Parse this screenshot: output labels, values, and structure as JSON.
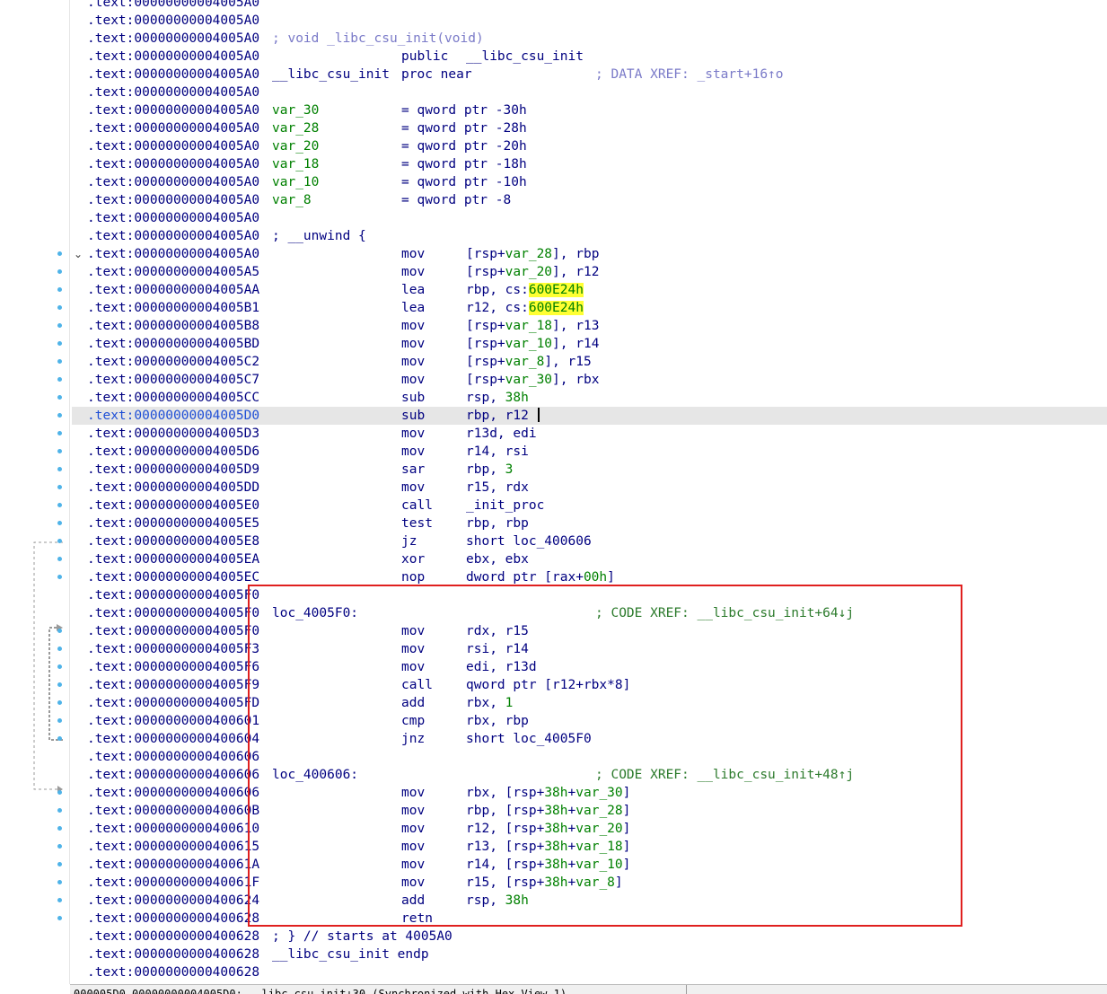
{
  "listing": {
    "rows": [
      {
        "addr": ".text:00000000004005A0",
        "lbl": "",
        "mnem": "",
        "ops": [],
        "cmt": ""
      },
      {
        "addr": ".text:00000000004005A0",
        "lbl": "",
        "mnem": "",
        "ops": [],
        "cmt": ""
      },
      {
        "addr": ".text:00000000004005A0",
        "lbl": "",
        "mnem": "",
        "ops": [
          {
            "t": "; void _libc_csu_init(void)",
            "c": "c"
          }
        ],
        "cmt": "",
        "opsAt": "lbl"
      },
      {
        "addr": ".text:00000000004005A0",
        "lbl": "",
        "mnem": "public",
        "ops": [
          {
            "t": "__libc_csu_init",
            "c": ""
          }
        ],
        "cmt": ""
      },
      {
        "addr": ".text:00000000004005A0",
        "lbl": "__libc_csu_init",
        "mnem": "proc near",
        "ops": [],
        "cmt": "; DATA XREF: _start+16↑o"
      },
      {
        "addr": ".text:00000000004005A0",
        "lbl": "",
        "mnem": "",
        "ops": [],
        "cmt": ""
      },
      {
        "addr": ".text:00000000004005A0",
        "lbl": "var_30",
        "lblc": "g",
        "mnem": "= qword ptr -30h",
        "ops": [],
        "cmt": ""
      },
      {
        "addr": ".text:00000000004005A0",
        "lbl": "var_28",
        "lblc": "g",
        "mnem": "= qword ptr -28h",
        "ops": [],
        "cmt": ""
      },
      {
        "addr": ".text:00000000004005A0",
        "lbl": "var_20",
        "lblc": "g",
        "mnem": "= qword ptr -20h",
        "ops": [],
        "cmt": ""
      },
      {
        "addr": ".text:00000000004005A0",
        "lbl": "var_18",
        "lblc": "g",
        "mnem": "= qword ptr -18h",
        "ops": [],
        "cmt": ""
      },
      {
        "addr": ".text:00000000004005A0",
        "lbl": "var_10",
        "lblc": "g",
        "mnem": "= qword ptr -10h",
        "ops": [],
        "cmt": ""
      },
      {
        "addr": ".text:00000000004005A0",
        "lbl": "var_8",
        "lblc": "g",
        "mnem": "= qword ptr -8",
        "ops": [],
        "cmt": ""
      },
      {
        "addr": ".text:00000000004005A0",
        "lbl": "",
        "mnem": "",
        "ops": [],
        "cmt": ""
      },
      {
        "addr": ".text:00000000004005A0",
        "lbl": "; __unwind {",
        "mnem": "",
        "ops": [],
        "cmt": ""
      },
      {
        "addr": ".text:00000000004005A0",
        "lbl": "",
        "mnem": "mov",
        "ops": [
          {
            "t": "[rsp+",
            "c": ""
          },
          {
            "t": "var_28",
            "c": "g"
          },
          {
            "t": "], rbp",
            "c": ""
          }
        ],
        "cmt": ""
      },
      {
        "addr": ".text:00000000004005A5",
        "lbl": "",
        "mnem": "mov",
        "ops": [
          {
            "t": "[rsp+",
            "c": ""
          },
          {
            "t": "var_20",
            "c": "g"
          },
          {
            "t": "], r12",
            "c": ""
          }
        ],
        "cmt": ""
      },
      {
        "addr": ".text:00000000004005AA",
        "lbl": "",
        "mnem": "lea",
        "ops": [
          {
            "t": "rbp, cs:",
            "c": ""
          },
          {
            "t": "600E24h",
            "c": "hl"
          }
        ],
        "cmt": ""
      },
      {
        "addr": ".text:00000000004005B1",
        "lbl": "",
        "mnem": "lea",
        "ops": [
          {
            "t": "r12, cs:",
            "c": ""
          },
          {
            "t": "600E24h",
            "c": "hl"
          }
        ],
        "cmt": ""
      },
      {
        "addr": ".text:00000000004005B8",
        "lbl": "",
        "mnem": "mov",
        "ops": [
          {
            "t": "[rsp+",
            "c": ""
          },
          {
            "t": "var_18",
            "c": "g"
          },
          {
            "t": "], r13",
            "c": ""
          }
        ],
        "cmt": ""
      },
      {
        "addr": ".text:00000000004005BD",
        "lbl": "",
        "mnem": "mov",
        "ops": [
          {
            "t": "[rsp+",
            "c": ""
          },
          {
            "t": "var_10",
            "c": "g"
          },
          {
            "t": "], r14",
            "c": ""
          }
        ],
        "cmt": ""
      },
      {
        "addr": ".text:00000000004005C2",
        "lbl": "",
        "mnem": "mov",
        "ops": [
          {
            "t": "[rsp+",
            "c": ""
          },
          {
            "t": "var_8",
            "c": "g"
          },
          {
            "t": "], r15",
            "c": ""
          }
        ],
        "cmt": ""
      },
      {
        "addr": ".text:00000000004005C7",
        "lbl": "",
        "mnem": "mov",
        "ops": [
          {
            "t": "[rsp+",
            "c": ""
          },
          {
            "t": "var_30",
            "c": "g"
          },
          {
            "t": "], rbx",
            "c": ""
          }
        ],
        "cmt": ""
      },
      {
        "addr": ".text:00000000004005CC",
        "lbl": "",
        "mnem": "sub",
        "ops": [
          {
            "t": "rsp, ",
            "c": ""
          },
          {
            "t": "38h",
            "c": "g"
          }
        ],
        "cmt": ""
      },
      {
        "addr": ".text:00000000004005D0",
        "lbl": "",
        "mnem": "sub",
        "ops": [
          {
            "t": "rbp, r12",
            "c": ""
          }
        ],
        "cmt": "",
        "current": true
      },
      {
        "addr": ".text:00000000004005D3",
        "lbl": "",
        "mnem": "mov",
        "ops": [
          {
            "t": "r13d, edi",
            "c": ""
          }
        ],
        "cmt": ""
      },
      {
        "addr": ".text:00000000004005D6",
        "lbl": "",
        "mnem": "mov",
        "ops": [
          {
            "t": "r14, rsi",
            "c": ""
          }
        ],
        "cmt": ""
      },
      {
        "addr": ".text:00000000004005D9",
        "lbl": "",
        "mnem": "sar",
        "ops": [
          {
            "t": "rbp, ",
            "c": ""
          },
          {
            "t": "3",
            "c": "g"
          }
        ],
        "cmt": ""
      },
      {
        "addr": ".text:00000000004005DD",
        "lbl": "",
        "mnem": "mov",
        "ops": [
          {
            "t": "r15, rdx",
            "c": ""
          }
        ],
        "cmt": ""
      },
      {
        "addr": ".text:00000000004005E0",
        "lbl": "",
        "mnem": "call",
        "ops": [
          {
            "t": "_init_proc",
            "c": ""
          }
        ],
        "cmt": ""
      },
      {
        "addr": ".text:00000000004005E5",
        "lbl": "",
        "mnem": "test",
        "ops": [
          {
            "t": "rbp, rbp",
            "c": ""
          }
        ],
        "cmt": ""
      },
      {
        "addr": ".text:00000000004005E8",
        "lbl": "",
        "mnem": "jz",
        "ops": [
          {
            "t": "short loc_400606",
            "c": ""
          }
        ],
        "cmt": ""
      },
      {
        "addr": ".text:00000000004005EA",
        "lbl": "",
        "mnem": "xor",
        "ops": [
          {
            "t": "ebx, ebx",
            "c": ""
          }
        ],
        "cmt": ""
      },
      {
        "addr": ".text:00000000004005EC",
        "lbl": "",
        "mnem": "nop",
        "ops": [
          {
            "t": "dword ptr [rax+",
            "c": ""
          },
          {
            "t": "00h",
            "c": "g"
          },
          {
            "t": "]",
            "c": ""
          }
        ],
        "cmt": ""
      },
      {
        "addr": ".text:00000000004005F0",
        "lbl": "",
        "mnem": "",
        "ops": [],
        "cmt": ""
      },
      {
        "addr": ".text:00000000004005F0",
        "lbl": "loc_4005F0:",
        "mnem": "",
        "ops": [],
        "cmt": "; CODE XREF: __libc_csu_init+64↓j",
        "cmtc": "code"
      },
      {
        "addr": ".text:00000000004005F0",
        "lbl": "",
        "mnem": "mov",
        "ops": [
          {
            "t": "rdx, r15",
            "c": ""
          }
        ],
        "cmt": ""
      },
      {
        "addr": ".text:00000000004005F3",
        "lbl": "",
        "mnem": "mov",
        "ops": [
          {
            "t": "rsi, r14",
            "c": ""
          }
        ],
        "cmt": ""
      },
      {
        "addr": ".text:00000000004005F6",
        "lbl": "",
        "mnem": "mov",
        "ops": [
          {
            "t": "edi, r13d",
            "c": ""
          }
        ],
        "cmt": ""
      },
      {
        "addr": ".text:00000000004005F9",
        "lbl": "",
        "mnem": "call",
        "ops": [
          {
            "t": "qword ptr [r12+rbx*8]",
            "c": ""
          }
        ],
        "cmt": ""
      },
      {
        "addr": ".text:00000000004005FD",
        "lbl": "",
        "mnem": "add",
        "ops": [
          {
            "t": "rbx, ",
            "c": ""
          },
          {
            "t": "1",
            "c": "g"
          }
        ],
        "cmt": ""
      },
      {
        "addr": ".text:0000000000400601",
        "lbl": "",
        "mnem": "cmp",
        "ops": [
          {
            "t": "rbx, rbp",
            "c": ""
          }
        ],
        "cmt": ""
      },
      {
        "addr": ".text:0000000000400604",
        "lbl": "",
        "mnem": "jnz",
        "ops": [
          {
            "t": "short loc_4005F0",
            "c": ""
          }
        ],
        "cmt": ""
      },
      {
        "addr": ".text:0000000000400606",
        "lbl": "",
        "mnem": "",
        "ops": [],
        "cmt": ""
      },
      {
        "addr": ".text:0000000000400606",
        "lbl": "loc_400606:",
        "mnem": "",
        "ops": [],
        "cmt": "; CODE XREF: __libc_csu_init+48↑j",
        "cmtc": "code"
      },
      {
        "addr": ".text:0000000000400606",
        "lbl": "",
        "mnem": "mov",
        "ops": [
          {
            "t": "rbx, [rsp+",
            "c": ""
          },
          {
            "t": "38h",
            "c": "g"
          },
          {
            "t": "+",
            "c": ""
          },
          {
            "t": "var_30",
            "c": "g"
          },
          {
            "t": "]",
            "c": ""
          }
        ],
        "cmt": ""
      },
      {
        "addr": ".text:000000000040060B",
        "lbl": "",
        "mnem": "mov",
        "ops": [
          {
            "t": "rbp, [rsp+",
            "c": ""
          },
          {
            "t": "38h",
            "c": "g"
          },
          {
            "t": "+",
            "c": ""
          },
          {
            "t": "var_28",
            "c": "g"
          },
          {
            "t": "]",
            "c": ""
          }
        ],
        "cmt": ""
      },
      {
        "addr": ".text:0000000000400610",
        "lbl": "",
        "mnem": "mov",
        "ops": [
          {
            "t": "r12, [rsp+",
            "c": ""
          },
          {
            "t": "38h",
            "c": "g"
          },
          {
            "t": "+",
            "c": ""
          },
          {
            "t": "var_20",
            "c": "g"
          },
          {
            "t": "]",
            "c": ""
          }
        ],
        "cmt": ""
      },
      {
        "addr": ".text:0000000000400615",
        "lbl": "",
        "mnem": "mov",
        "ops": [
          {
            "t": "r13, [rsp+",
            "c": ""
          },
          {
            "t": "38h",
            "c": "g"
          },
          {
            "t": "+",
            "c": ""
          },
          {
            "t": "var_18",
            "c": "g"
          },
          {
            "t": "]",
            "c": ""
          }
        ],
        "cmt": ""
      },
      {
        "addr": ".text:000000000040061A",
        "lbl": "",
        "mnem": "mov",
        "ops": [
          {
            "t": "r14, [rsp+",
            "c": ""
          },
          {
            "t": "38h",
            "c": "g"
          },
          {
            "t": "+",
            "c": ""
          },
          {
            "t": "var_10",
            "c": "g"
          },
          {
            "t": "]",
            "c": ""
          }
        ],
        "cmt": ""
      },
      {
        "addr": ".text:000000000040061F",
        "lbl": "",
        "mnem": "mov",
        "ops": [
          {
            "t": "r15, [rsp+",
            "c": ""
          },
          {
            "t": "38h",
            "c": "g"
          },
          {
            "t": "+",
            "c": ""
          },
          {
            "t": "var_8",
            "c": "g"
          },
          {
            "t": "]",
            "c": ""
          }
        ],
        "cmt": ""
      },
      {
        "addr": ".text:0000000000400624",
        "lbl": "",
        "mnem": "add",
        "ops": [
          {
            "t": "rsp, ",
            "c": ""
          },
          {
            "t": "38h",
            "c": "g"
          }
        ],
        "cmt": ""
      },
      {
        "addr": ".text:0000000000400628",
        "lbl": "",
        "mnem": "retn",
        "ops": [],
        "cmt": ""
      },
      {
        "addr": ".text:0000000000400628",
        "lbl": "; } // starts at 4005A0",
        "mnem": "",
        "ops": [],
        "cmt": ""
      },
      {
        "addr": ".text:0000000000400628",
        "lbl": "__libc_csu_init endp",
        "mnem": "",
        "ops": [],
        "cmt": ""
      },
      {
        "addr": ".text:0000000000400628",
        "lbl": "",
        "mnem": "",
        "ops": [],
        "cmt": ""
      }
    ]
  },
  "status_bar": {
    "text": "000005D0 00000000004005D0: __libc_csu_init+30 (Synchronized with Hex View-1)"
  },
  "colors": {
    "address": "#000080",
    "operand_green": "#008000",
    "comment_purple": "#7a7ac8",
    "highlight_yellow": "#ffff33",
    "current_line": "#e6e6e6",
    "gutter_dot": "#4fb3e8",
    "annotation_box": "#e0201f"
  },
  "icons": {
    "fold": "chevron-down-icon"
  }
}
